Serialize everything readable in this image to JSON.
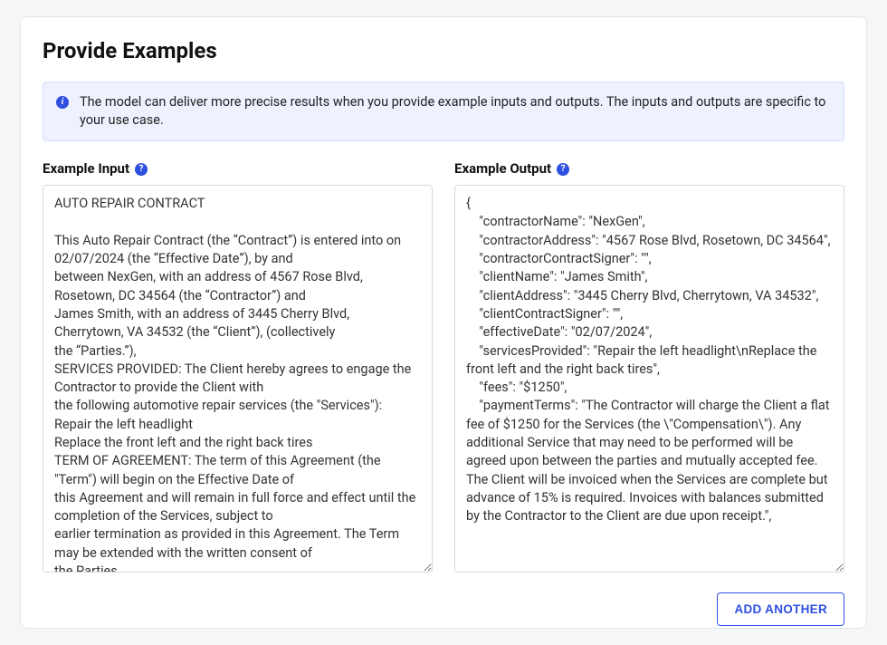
{
  "header": {
    "title": "Provide Examples"
  },
  "info": {
    "text": "The model can deliver more precise results when you provide example inputs and outputs. The inputs and outputs are specific to your use case."
  },
  "labels": {
    "input": "Example Input",
    "output": "Example Output"
  },
  "example": {
    "input": "AUTO REPAIR CONTRACT\n\nThis Auto Repair Contract (the “Contract”) is entered into on 02/07/2024 (the “Effective Date”), by and\nbetween NexGen, with an address of 4567 Rose Blvd, Rosetown, DC 34564 (the “Contractor”) and\nJames Smith, with an address of 3445 Cherry Blvd, Cherrytown, VA 34532 (the “Client”), (collectively\nthe “Parties.”),\nSERVICES PROVIDED: The Client hereby agrees to engage the Contractor to provide the Client with\nthe following automotive repair services (the \"Services\"):\nRepair the left headlight\nReplace the front left and the right back tires\nTERM OF AGREEMENT: The term of this Agreement (the \"Term\") will begin on the Effective Date of\nthis Agreement and will remain in full force and effect until the completion of the Services, subject to\nearlier termination as provided in this Agreement. The Term may be extended with the written consent of\nthe Parties.",
    "output": "{\n    \"contractorName\": \"NexGen\",\n    \"contractorAddress\": \"4567 Rose Blvd, Rosetown, DC 34564\",\n    \"contractorContractSigner\": \"\",\n    \"clientName\": \"James Smith\",\n    \"clientAddress\": \"3445 Cherry Blvd, Cherrytown, VA 34532\",\n    \"clientContractSigner\": \"\",\n    \"effectiveDate\": \"02/07/2024\",\n    \"servicesProvided\": \"Repair the left headlight\\nReplace the front left and the right back tires\",\n    \"fees\": \"$1250\",\n    \"paymentTerms\": \"The Contractor will charge the Client a flat fee of $1250 for the Services (the \\\"Compensation\\\"). Any additional Service that may need to be performed will be agreed upon between the parties and mutually accepted fee. The Client will be invoiced when the Services are complete but advance of 15% is required. Invoices with balances submitted by the Contractor to the Client are due upon receipt.\","
  },
  "buttons": {
    "addAnother": "ADD ANOTHER"
  },
  "icons": {
    "info": "i",
    "help": "?"
  }
}
